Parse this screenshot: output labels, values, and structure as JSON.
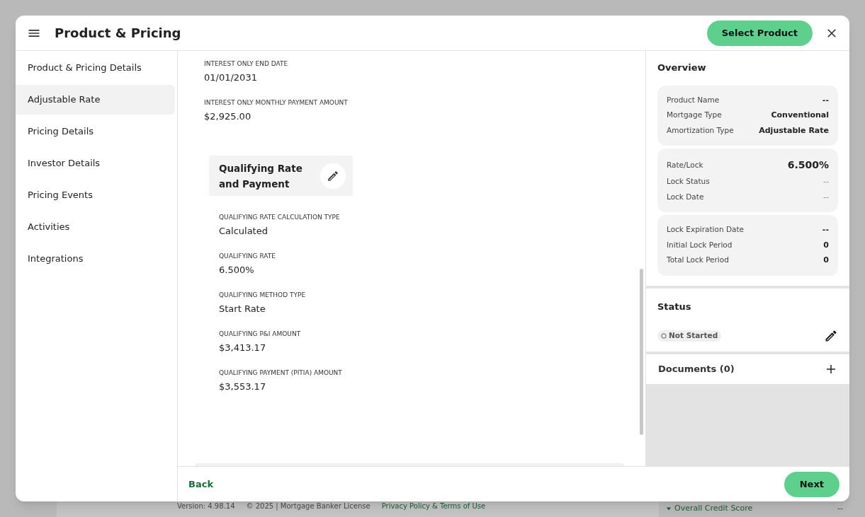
{
  "background": {
    "version": "Version: 4.98.14",
    "copyright": "© 2025 | Mortgage Banker License",
    "link": "Privacy Policy & Terms of Use",
    "credit_label": "Overall Credit Score",
    "credit_value": "--"
  },
  "header": {
    "title": "Product & Pricing",
    "action": "Select Product"
  },
  "nav": [
    {
      "label": "Product & Pricing Details",
      "selected": false
    },
    {
      "label": "Adjustable Rate",
      "selected": true
    },
    {
      "label": "Pricing Details",
      "selected": false
    },
    {
      "label": "Investor Details",
      "selected": false
    },
    {
      "label": "Pricing Events",
      "selected": false
    },
    {
      "label": "Activities",
      "selected": false
    },
    {
      "label": "Integrations",
      "selected": false
    }
  ],
  "fields": [
    {
      "label": "INTEREST ONLY END DATE",
      "value": "01/01/2031"
    },
    {
      "label": "INTEREST ONLY MONTHLY PAYMENT AMOUNT",
      "value": "$2,925.00"
    }
  ],
  "qualifying": {
    "title": "Qualifying Rate and Payment",
    "fields": [
      {
        "label": "QUALIFYING RATE CALCULATION TYPE",
        "value": "Calculated"
      },
      {
        "label": "QUALIFYING RATE",
        "value": "6.500%"
      },
      {
        "label": "QUALIFYING METHOD TYPE",
        "value": "Start Rate"
      },
      {
        "label": "QUALIFYING P&I AMOUNT",
        "value": "$3,413.17"
      },
      {
        "label": "QUALIFYING PAYMENT (PITIA) AMOUNT",
        "value": "$3,553.17"
      }
    ]
  },
  "overview": {
    "title": "Overview",
    "cards": [
      [
        {
          "label": "Product Name",
          "value": "--",
          "kind": "bold"
        },
        {
          "label": "Mortgage Type",
          "value": "Conventional",
          "kind": "bold"
        },
        {
          "label": "Amortization Type",
          "value": "Adjustable Rate",
          "kind": "bold"
        }
      ],
      [
        {
          "label": "Rate/Lock",
          "value": "6.500%",
          "kind": "large"
        },
        {
          "label": "Lock Status",
          "value": "--",
          "kind": "plain"
        },
        {
          "label": "Lock Date",
          "value": "--",
          "kind": "plain"
        }
      ],
      [
        {
          "label": "Lock Expiration Date",
          "value": "--",
          "kind": "bold"
        },
        {
          "label": "Initial Lock Period",
          "value": "0",
          "kind": "bold"
        },
        {
          "label": "Total Lock Period",
          "value": "0",
          "kind": "bold"
        }
      ]
    ]
  },
  "status": {
    "title": "Status",
    "badge": "Not Started"
  },
  "documents": {
    "title": "Documents (0)"
  },
  "footer": {
    "back": "Back",
    "next": "Next"
  }
}
